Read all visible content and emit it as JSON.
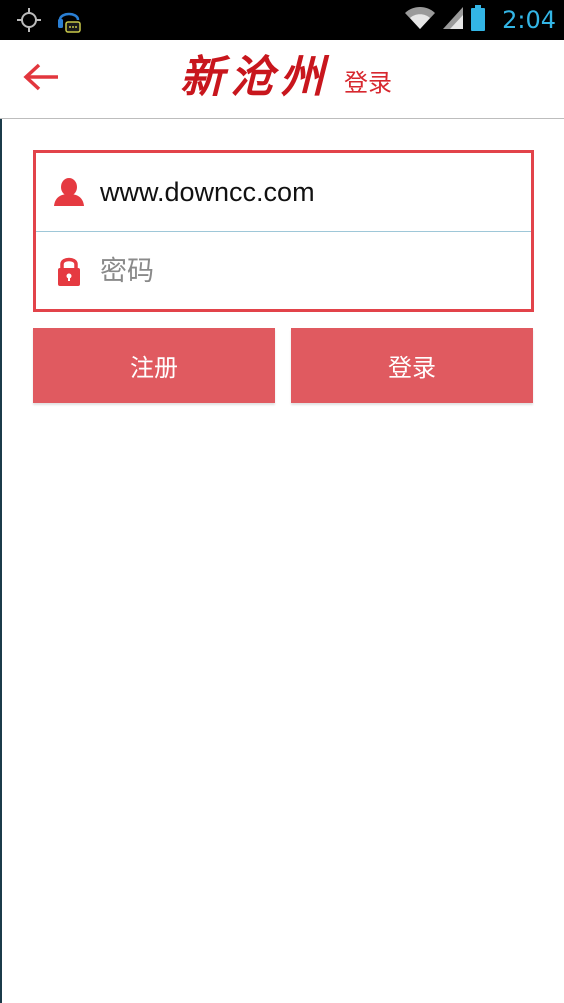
{
  "status_bar": {
    "time": "2:04",
    "icons": [
      "gps-icon",
      "headset-chat-icon",
      "wifi-icon",
      "signal-icon",
      "battery-icon"
    ]
  },
  "header": {
    "brand": "新沧州",
    "title": "登录",
    "back_icon": "arrow-left-icon"
  },
  "login_form": {
    "username_value": "www.downcc.com",
    "password_placeholder": "密码",
    "username_icon": "user-icon",
    "password_icon": "lock-icon"
  },
  "buttons": {
    "register_label": "注册",
    "login_label": "登录"
  },
  "colors": {
    "accent": "#e05a60",
    "brand_red": "#c8161d",
    "status_time": "#33b5e5"
  }
}
